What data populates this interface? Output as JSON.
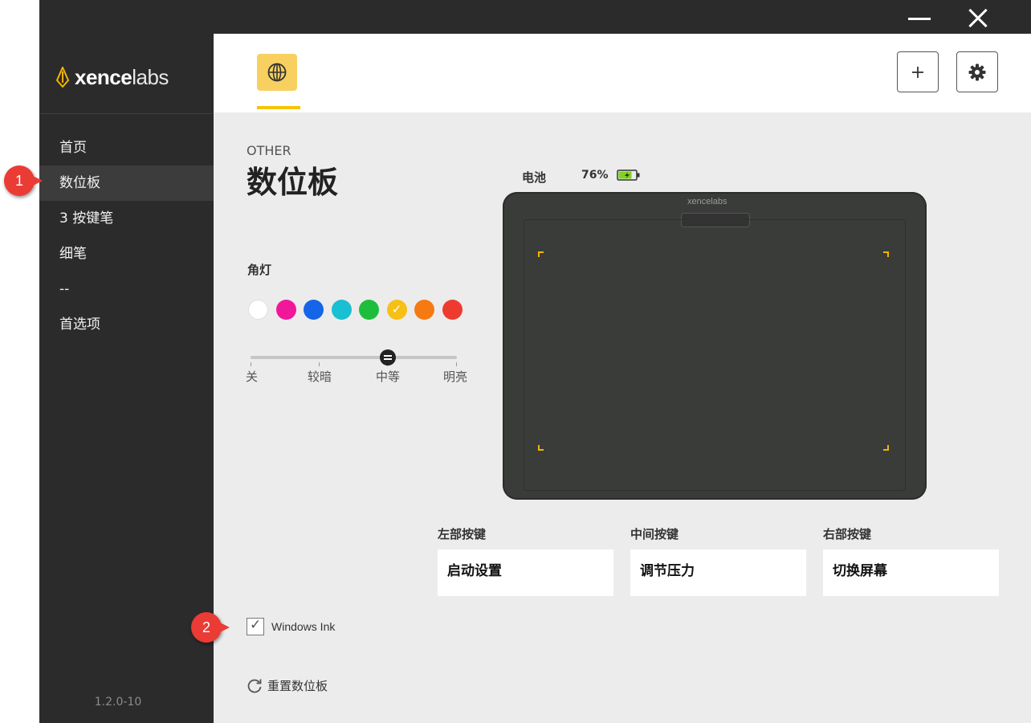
{
  "window": {
    "minimize_label": "—",
    "close_label": "✕"
  },
  "sidebar": {
    "logo_bold": "xence",
    "logo_light": "labs",
    "items": [
      {
        "label": "首页"
      },
      {
        "label": "数位板"
      },
      {
        "label": "3 按键笔"
      },
      {
        "label": "细笔"
      },
      {
        "label": "--"
      },
      {
        "label": "首选项"
      }
    ],
    "active_index": 1,
    "version": "1.2.0-10"
  },
  "topbar": {
    "tab_icon": "globe-icon",
    "add_icon": "plus-icon",
    "settings_icon": "gear-icon",
    "accent_color": "#f5c400"
  },
  "page": {
    "subtitle": "OTHER",
    "title": "数位板"
  },
  "corner_light": {
    "label": "角灯",
    "colors": [
      "#ffffff",
      "#f0179b",
      "#1565e8",
      "#19bfd2",
      "#1ebe3c",
      "#f6c015",
      "#f57a12",
      "#ee3b2f"
    ],
    "selected_index": 5,
    "brightness": {
      "levels": [
        "关",
        "较暗",
        "中等",
        "明亮"
      ],
      "selected_index": 2
    }
  },
  "battery": {
    "label": "电池",
    "value": "76%",
    "level": 0.76
  },
  "device": {
    "logo": "xencelabs"
  },
  "keys": {
    "left": {
      "label": "左部按键",
      "value": "启动设置"
    },
    "middle": {
      "label": "中间按键",
      "value": "调节压力"
    },
    "right": {
      "label": "右部按键",
      "value": "切换屏幕"
    }
  },
  "windows_ink": {
    "label": "Windows Ink",
    "checked": true
  },
  "reset": {
    "label": "重置数位板"
  },
  "callouts": [
    "1",
    "2"
  ]
}
